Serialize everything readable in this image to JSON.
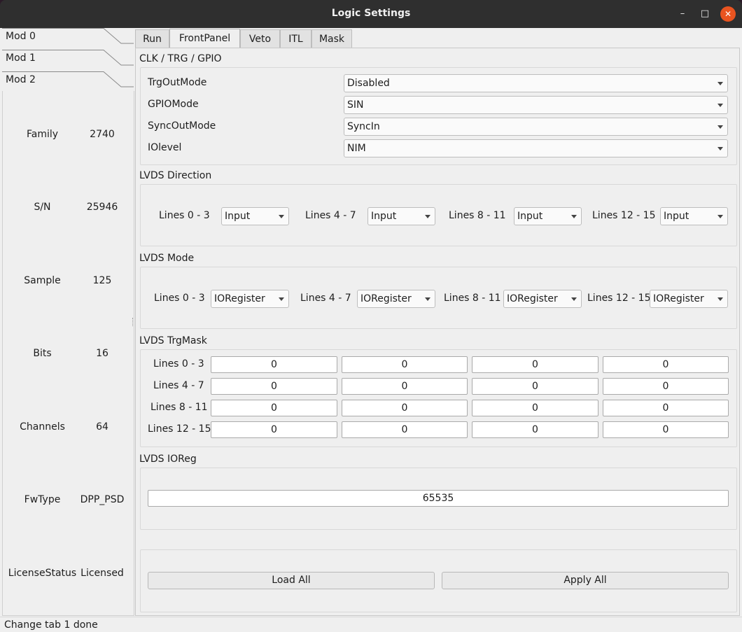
{
  "window": {
    "title": "Logic Settings"
  },
  "window_controls": {
    "minimize": "–",
    "maximize": "□",
    "close": "✕"
  },
  "modules": [
    "Mod 0",
    "Mod 1",
    "Mod 2"
  ],
  "info": [
    {
      "key": "Family",
      "value": "2740"
    },
    {
      "key": "S/N",
      "value": "25946"
    },
    {
      "key": "Sample",
      "value": "125"
    },
    {
      "key": "Bits",
      "value": "16"
    },
    {
      "key": "Channels",
      "value": "64"
    },
    {
      "key": "FwType",
      "value": "DPP_PSD"
    },
    {
      "key": "LicenseStatus",
      "value": "Licensed"
    }
  ],
  "tabs": [
    "Run",
    "FrontPanel",
    "Veto",
    "ITL",
    "Mask"
  ],
  "active_tab": "FrontPanel",
  "clk": {
    "title": "CLK / TRG / GPIO",
    "rows": [
      {
        "label": "TrgOutMode",
        "value": "Disabled"
      },
      {
        "label": "GPIOMode",
        "value": "SIN"
      },
      {
        "label": "SyncOutMode",
        "value": "SyncIn"
      },
      {
        "label": "IOlevel",
        "value": "NIM"
      }
    ]
  },
  "lvds_direction": {
    "title": "LVDS Direction",
    "items": [
      {
        "label": "Lines 0 - 3",
        "value": "Input"
      },
      {
        "label": "Lines 4 - 7",
        "value": "Input"
      },
      {
        "label": "Lines 8 - 11",
        "value": "Input"
      },
      {
        "label": "Lines 12 - 15",
        "value": "Input"
      }
    ]
  },
  "lvds_mode": {
    "title": "LVDS Mode",
    "items": [
      {
        "label": "Lines 0 - 3",
        "value": "IORegister"
      },
      {
        "label": "Lines 4 - 7",
        "value": "IORegister"
      },
      {
        "label": "Lines 8 - 11",
        "value": "IORegister"
      },
      {
        "label": "Lines 12 - 15",
        "value": "IORegister"
      }
    ]
  },
  "lvds_trgmask": {
    "title": "LVDS TrgMask",
    "rows": [
      {
        "label": "Lines 0 - 3",
        "values": [
          "0",
          "0",
          "0",
          "0"
        ]
      },
      {
        "label": "Lines 4 - 7",
        "values": [
          "0",
          "0",
          "0",
          "0"
        ]
      },
      {
        "label": "Lines 8 - 11",
        "values": [
          "0",
          "0",
          "0",
          "0"
        ]
      },
      {
        "label": "Lines 12 - 15",
        "values": [
          "0",
          "0",
          "0",
          "0"
        ]
      }
    ]
  },
  "lvds_ioreg": {
    "title": "LVDS IOReg",
    "value": "65535"
  },
  "buttons": {
    "load_all": "Load All",
    "apply_all": "Apply All"
  },
  "status": "Change tab 1 done"
}
